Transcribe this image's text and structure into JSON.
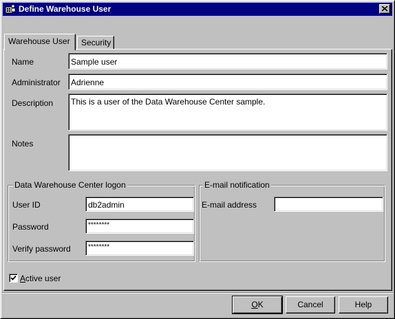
{
  "window": {
    "title": "Define Warehouse User",
    "close_label": "×"
  },
  "tabs": [
    {
      "label": "Warehouse User",
      "active": true
    },
    {
      "label": "Security",
      "active": false
    }
  ],
  "form": {
    "name_label": "Name",
    "name_value": "Sample user",
    "administrator_label": "Administrator",
    "administrator_value": "Adrienne",
    "description_label": "Description",
    "description_value": "This is a user of the Data Warehouse Center sample.",
    "notes_label": "Notes",
    "notes_value": ""
  },
  "logon_group": {
    "title": "Data Warehouse Center logon",
    "user_id_label": "User ID",
    "user_id_value": "db2admin",
    "password_label": "Password",
    "password_value": "********",
    "verify_label": "Verify password",
    "verify_value": "********"
  },
  "email_group": {
    "title": "E-mail notification",
    "address_label": "E-mail address",
    "address_value": ""
  },
  "active_user": {
    "label_first": "A",
    "label_rest": "ctive user",
    "checked": true
  },
  "buttons": {
    "ok_first": "O",
    "ok_rest": "K",
    "cancel": "Cancel",
    "help": "Help"
  },
  "colors": {
    "titlebar": "#000080",
    "face": "#c0c0c0"
  }
}
